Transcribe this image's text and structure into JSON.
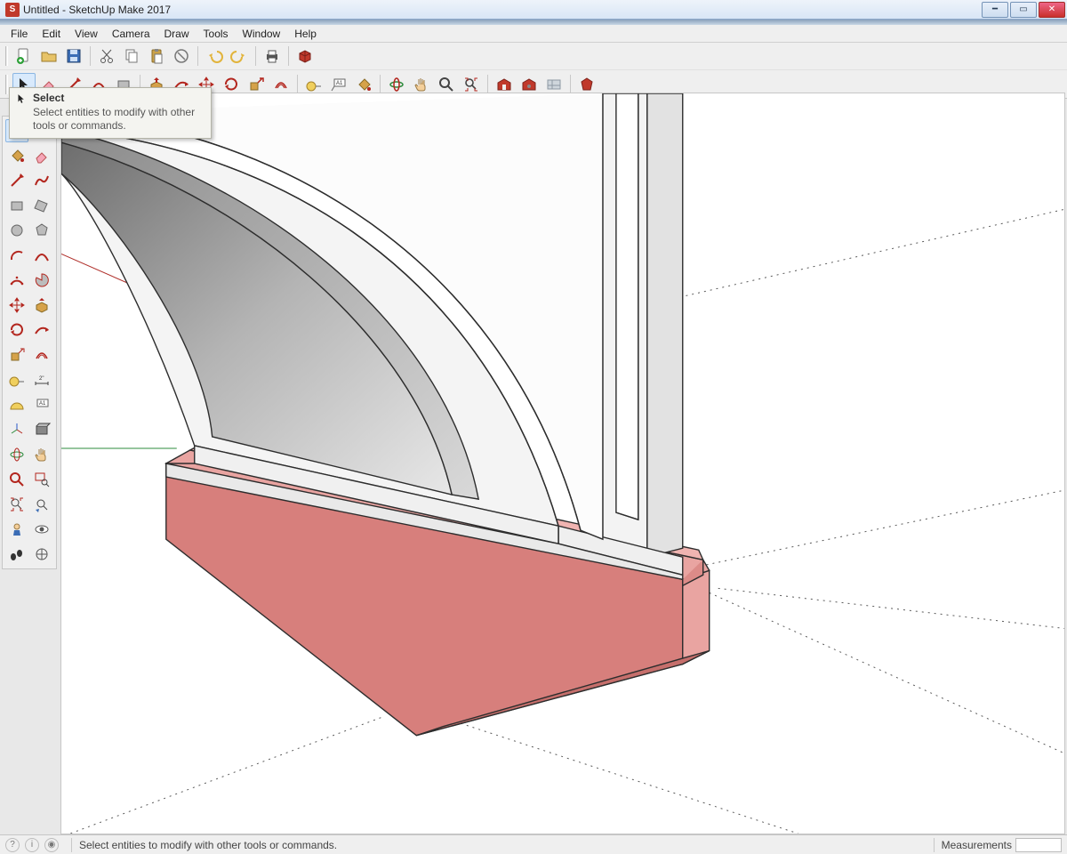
{
  "window": {
    "title": "Untitled - SketchUp Make 2017"
  },
  "menu": {
    "items": [
      "File",
      "Edit",
      "View",
      "Camera",
      "Draw",
      "Tools",
      "Window",
      "Help"
    ]
  },
  "tooltip": {
    "title": "Select",
    "body": "Select entities to modify with other tools or commands."
  },
  "status": {
    "hint": "Select entities to modify with other tools or commands.",
    "measurements_label": "Measurements"
  },
  "toolbar_row1": {
    "items": [
      "new-file",
      "open-file",
      "save-file",
      "cut",
      "copy",
      "paste",
      "delete",
      "undo",
      "redo",
      "print",
      "model-info"
    ]
  },
  "toolbar_row2": {
    "items": [
      "select",
      "eraser",
      "line",
      "arc",
      "shape",
      "push-pull",
      "follow-me",
      "move",
      "rotate",
      "scale",
      "offset",
      "tape-measure",
      "text-label",
      "paint-bucket",
      "orbit",
      "pan",
      "zoom",
      "zoom-extents",
      "3d-warehouse",
      "extension-warehouse",
      "layers",
      "ruby-console"
    ]
  },
  "left_tray": {
    "items": [
      "select",
      "make-component",
      "eraser",
      "paint-bucket",
      "line",
      "freehand",
      "rectangle",
      "arc",
      "circle",
      "polygon",
      "pie",
      "2pt-arc",
      "move",
      "offset",
      "rotate",
      "follow-me",
      "push-pull",
      "scale",
      "tape-measure",
      "protractor",
      "dimension",
      "text-label",
      "axes",
      "section-plane",
      "orbit",
      "pan",
      "zoom",
      "zoom-window",
      "zoom-extents",
      "previous-camera",
      "look-around",
      "walk",
      "position-camera"
    ]
  }
}
